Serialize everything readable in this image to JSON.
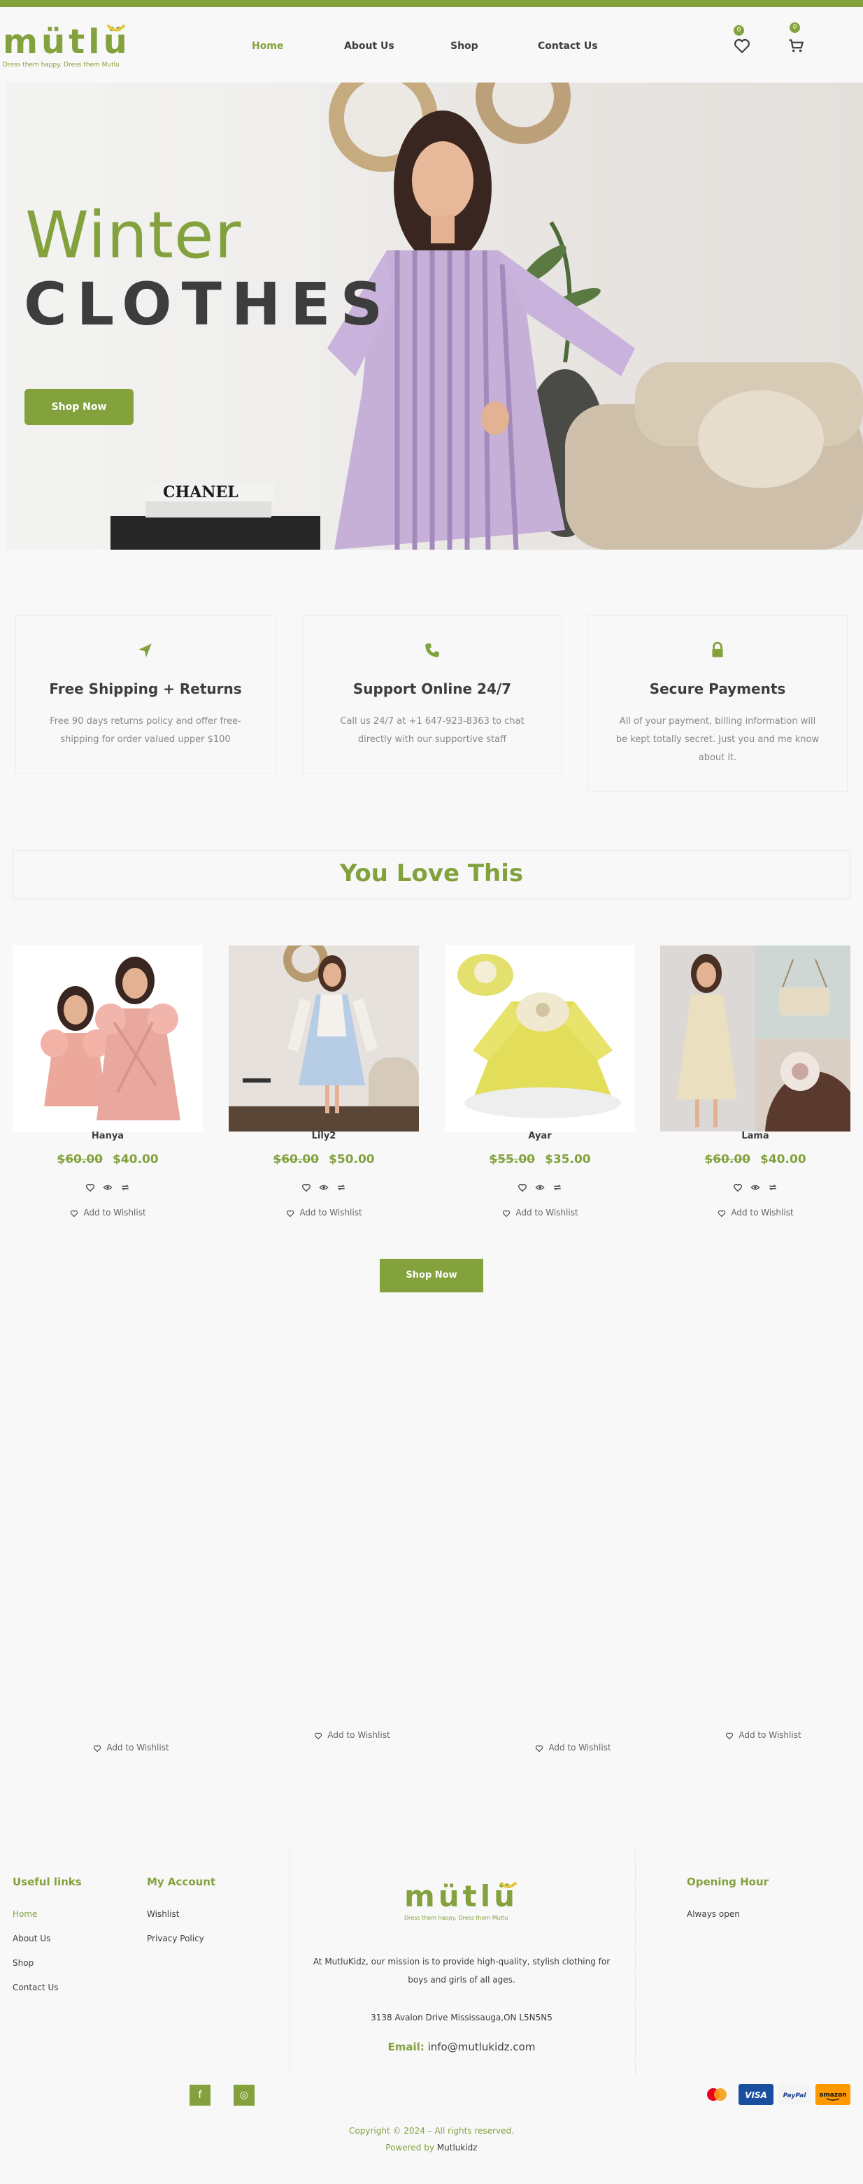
{
  "brand": {
    "logo_text": "mütlü",
    "tagline": "Dress them happy. Dress them Mutlu"
  },
  "nav": {
    "items": [
      {
        "label": "Home"
      },
      {
        "label": "About Us"
      },
      {
        "label": "Shop"
      },
      {
        "label": "Contact Us"
      }
    ],
    "wishlist_count": "0",
    "cart_count": "0"
  },
  "hero": {
    "title_line1": "Winter",
    "title_line2": "CLOTHES",
    "button_label": "Shop Now",
    "decor_text": "CHANEL"
  },
  "features": [
    {
      "icon": "location-arrow-icon",
      "title": "Free Shipping + Returns",
      "text": "Free 90 days returns policy and offer free-shipping for order valued upper $100"
    },
    {
      "icon": "phone-icon",
      "title": "Support Online 24/7",
      "text": "Call us 24/7 at +1 647-923-8363 to chat directly with our supportive staff"
    },
    {
      "icon": "lock-icon",
      "title": "Secure Payments",
      "text": "All of your payment, billing information will be kept totally secret. Just you and me know about it."
    }
  ],
  "section": {
    "title": "You Love This"
  },
  "products": [
    {
      "name": "Hanya",
      "old_price": "$60.00",
      "price": "$40.00",
      "wishlist_label": "Add to Wishlist"
    },
    {
      "name": "Lily2",
      "old_price": "$60.00",
      "price": "$50.00",
      "wishlist_label": "Add to Wishlist"
    },
    {
      "name": "Ayar",
      "old_price": "$55.00",
      "price": "$35.00",
      "wishlist_label": "Add to Wishlist"
    },
    {
      "name": "Lama",
      "old_price": "$60.00",
      "price": "$40.00",
      "wishlist_label": "Add to Wishlist"
    }
  ],
  "shop_button": "Shop Now",
  "lower_wishlist": [
    {
      "label": "Add to Wishlist"
    },
    {
      "label": "Add to Wishlist"
    },
    {
      "label": "Add to Wishlist"
    },
    {
      "label": "Add to Wishlist"
    }
  ],
  "footer": {
    "useful_links": {
      "title": "Useful links",
      "items": [
        {
          "label": "Home"
        },
        {
          "label": "About Us"
        },
        {
          "label": "Shop"
        },
        {
          "label": "Contact Us"
        }
      ]
    },
    "my_account": {
      "title": "My Account",
      "items": [
        {
          "label": "Wishlist"
        },
        {
          "label": "Privacy Policy"
        }
      ]
    },
    "mission": "At MutluKidz, our mission is to provide high-quality, stylish clothing for boys and girls of all ages.",
    "address": "3138 Avalon Drive Mississauga,ON L5N5N5",
    "email_label": "Email:",
    "email": "info@mutlukidz.com",
    "opening_hour": {
      "title": "Opening Hour",
      "text": "Always open"
    },
    "social": [
      {
        "icon": "facebook-icon",
        "glyph": "f"
      },
      {
        "icon": "instagram-icon",
        "glyph": "◎"
      }
    ],
    "payments": {
      "visa": "VISA",
      "paypal": "PayPal",
      "amazon": "amazon"
    },
    "copyright": "Copyright © 2024 – All rights reserved.",
    "powered_prefix": "Powered by",
    "powered_name": "Mutlukidz"
  },
  "colors": {
    "accent": "#83a23e",
    "text": "#3d3d3d",
    "background": "#f8f8f8"
  }
}
